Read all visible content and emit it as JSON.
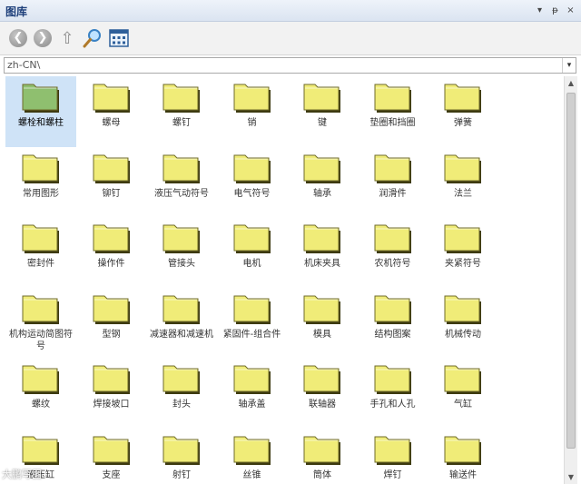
{
  "window": {
    "title": "图库",
    "controls": [
      "▾",
      "ᵽ",
      "×"
    ]
  },
  "toolbar": {
    "buttons": [
      {
        "name": "back",
        "glyph": "❮"
      },
      {
        "name": "forward",
        "glyph": "❯"
      },
      {
        "name": "up",
        "glyph": "⇧"
      },
      {
        "name": "search",
        "glyph": "🔍"
      },
      {
        "name": "views",
        "glyph": "▦"
      }
    ]
  },
  "path": {
    "value": "zh-CN\\",
    "dropdown_glyph": "▾"
  },
  "scroll": {
    "up": "▲",
    "down": "▼"
  },
  "folders": [
    {
      "label": "螺栓和螺柱",
      "selected": true
    },
    {
      "label": "螺母"
    },
    {
      "label": "螺钉"
    },
    {
      "label": "销"
    },
    {
      "label": "键"
    },
    {
      "label": "垫圈和挡圈"
    },
    {
      "label": "弹簧"
    },
    {
      "label": "常用图形"
    },
    {
      "label": "铆钉"
    },
    {
      "label": "液压气动符号"
    },
    {
      "label": "电气符号"
    },
    {
      "label": "轴承"
    },
    {
      "label": "润滑件"
    },
    {
      "label": "法兰"
    },
    {
      "label": "密封件"
    },
    {
      "label": "操作件"
    },
    {
      "label": "管接头"
    },
    {
      "label": "电机"
    },
    {
      "label": "机床夹具"
    },
    {
      "label": "农机符号"
    },
    {
      "label": "夹紧符号"
    },
    {
      "label": "机构运动简图符号"
    },
    {
      "label": "型钢"
    },
    {
      "label": "减速器和减速机"
    },
    {
      "label": "紧固件-组合件"
    },
    {
      "label": "模具"
    },
    {
      "label": "结构图案"
    },
    {
      "label": "机械传动"
    },
    {
      "label": "螺纹"
    },
    {
      "label": "焊接坡口"
    },
    {
      "label": "封头"
    },
    {
      "label": "轴承盖"
    },
    {
      "label": "联轴器"
    },
    {
      "label": "手孔和人孔"
    },
    {
      "label": "气缸"
    },
    {
      "label": "液压缸"
    },
    {
      "label": "支座"
    },
    {
      "label": "射钉"
    },
    {
      "label": "丝锥"
    },
    {
      "label": "筒体"
    },
    {
      "label": "焊钉"
    },
    {
      "label": "输送件"
    }
  ],
  "watermark": "大鹏写图",
  "colors": {
    "folder": "#f0ec78",
    "folder_edge": "#6f6b2a",
    "folder_selected": "#8fbf6f",
    "selection": "#cfe3f7"
  }
}
